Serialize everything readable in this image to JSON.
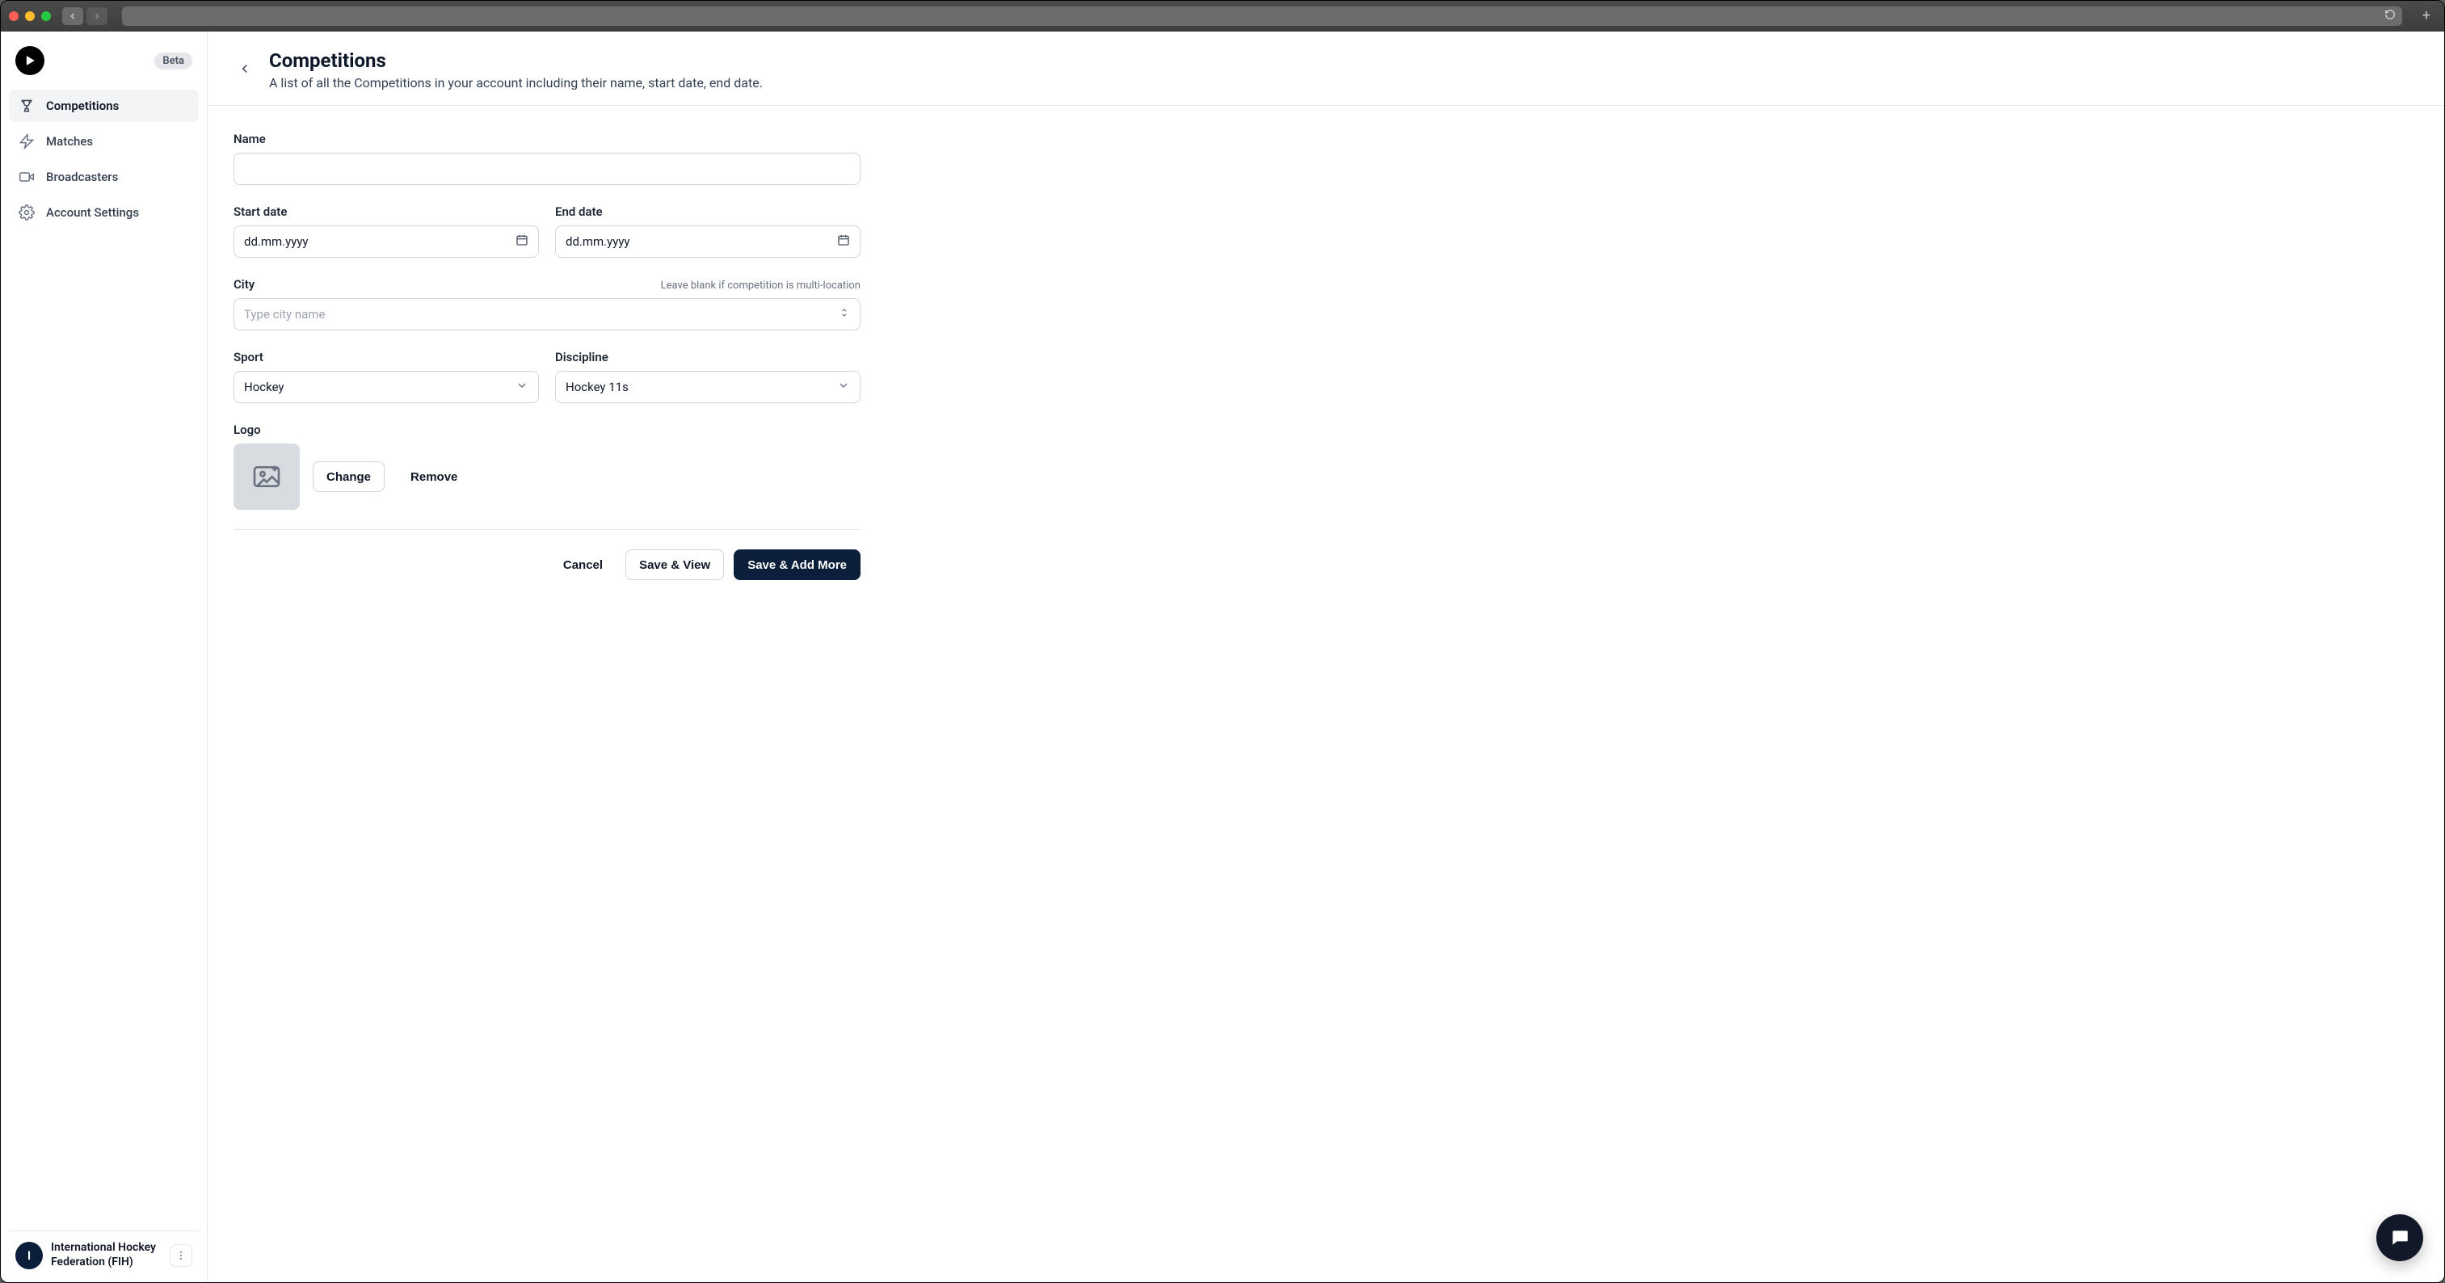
{
  "badge": "Beta",
  "sidebar": {
    "items": [
      {
        "label": "Competitions"
      },
      {
        "label": "Matches"
      },
      {
        "label": "Broadcasters"
      },
      {
        "label": "Account Settings"
      }
    ]
  },
  "header": {
    "title": "Competitions",
    "subtitle": "A list of all the Competitions in your account including their name, start date, end date."
  },
  "form": {
    "name_label": "Name",
    "start_label": "Start date",
    "start_placeholder": "dd.mm.yyyy",
    "end_label": "End date",
    "end_placeholder": "dd.mm.yyyy",
    "city_label": "City",
    "city_hint": "Leave blank if competition is multi-location",
    "city_placeholder": "Type city name",
    "sport_label": "Sport",
    "sport_value": "Hockey",
    "discipline_label": "Discipline",
    "discipline_value": "Hockey 11s",
    "logo_label": "Logo",
    "change_label": "Change",
    "remove_label": "Remove"
  },
  "actions": {
    "cancel": "Cancel",
    "save_view": "Save & View",
    "save_add": "Save & Add More"
  },
  "account": {
    "initial": "I",
    "name": "International Hockey Federation (FIH)"
  }
}
